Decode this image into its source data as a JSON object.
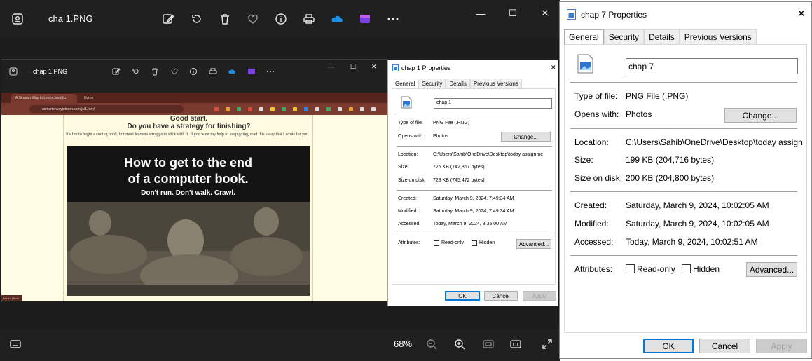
{
  "viewer": {
    "title": "cha 1.PNG",
    "zoom": "68%",
    "icons": [
      "image-gallery-icon",
      "edit-image-icon",
      "rotate-icon",
      "delete-icon",
      "favorite-heart-icon",
      "info-icon",
      "print-icon",
      "onedrive-cloud-icon",
      "clipchamp-icon",
      "more-icon"
    ],
    "window_controls": {
      "minimize": "—",
      "maximize": "☐",
      "close": "✕"
    }
  },
  "inner_viewer": {
    "title": "chap 1.PNG",
    "window_controls": {
      "minimize": "—",
      "maximize": "☐",
      "close": "✕"
    }
  },
  "browser": {
    "tab1": "A Smarter Way to Learn JavaScr",
    "tab2": "Home",
    "url": "asmarterwaytolearn.com/js/1.html",
    "heading1": "Good start.",
    "heading2": "Do you have a strategy for finishing?",
    "paragraph": "It's fun to begin a coding book, but most learners struggle to stick with it. If you want my help to keep going, read this essay that I wrote for you.",
    "hero_line1": "How to get to the end",
    "hero_line2": "of a computer book.",
    "hero_line3": "Don't run. Don't walk. Crawl.",
    "tiny_tab": "BoLeo | Amit"
  },
  "dialog_small": {
    "title": "chap 1 Properties",
    "close": "✕",
    "tabs": [
      "General",
      "Security",
      "Details",
      "Previous Versions"
    ],
    "name": "chap 1",
    "type_label": "Type of file:",
    "type_value": "PNG File (.PNG)",
    "opens_label": "Opens with:",
    "opens_value": "Photos",
    "change_button": "Change...",
    "location_label": "Location:",
    "location_value": "C:\\Users\\Sahib\\OneDrive\\Desktop\\today assignme",
    "size_label": "Size:",
    "size_value": "725 KB (742,867 bytes)",
    "size_disk_label": "Size on disk:",
    "size_disk_value": "728 KB (745,472 bytes)",
    "created_label": "Created:",
    "created_value": "Saturday, March 9, 2024, 7:49:34 AM",
    "modified_label": "Modified:",
    "modified_value": "Saturday, March 9, 2024, 7:49:34 AM",
    "accessed_label": "Accessed:",
    "accessed_value": "Today, March 9, 2024, 8:35:00 AM",
    "attributes_label": "Attributes:",
    "readonly_label": "Read-only",
    "hidden_label": "Hidden",
    "advanced_button": "Advanced...",
    "ok_button": "OK",
    "cancel_button": "Cancel",
    "apply_button": "Apply"
  },
  "dialog_large": {
    "title": "chap 7 Properties",
    "close": "✕",
    "tabs": [
      "General",
      "Security",
      "Details",
      "Previous Versions"
    ],
    "name": "chap 7",
    "type_label": "Type of file:",
    "type_value": "PNG File (.PNG)",
    "opens_label": "Opens with:",
    "opens_value": "Photos",
    "change_button": "Change...",
    "location_label": "Location:",
    "location_value": "C:\\Users\\Sahib\\OneDrive\\Desktop\\today assignme",
    "size_label": "Size:",
    "size_value": "199 KB (204,716 bytes)",
    "size_disk_label": "Size on disk:",
    "size_disk_value": "200 KB (204,800 bytes)",
    "created_label": "Created:",
    "created_value": "Saturday, March 9, 2024, 10:02:05 AM",
    "modified_label": "Modified:",
    "modified_value": "Saturday, March 9, 2024, 10:02:05 AM",
    "accessed_label": "Accessed:",
    "accessed_value": "Today, March 9, 2024, 10:02:51 AM",
    "attributes_label": "Attributes:",
    "readonly_label": "Read-only",
    "hidden_label": "Hidden",
    "advanced_button": "Advanced...",
    "ok_button": "OK",
    "cancel_button": "Cancel",
    "apply_button": "Apply"
  },
  "colors": {
    "viewer_bg": "#202020",
    "browser_tab_bg": "#55241d",
    "page_bg": "#fffbe0",
    "dialog_accent": "#0078d7"
  }
}
